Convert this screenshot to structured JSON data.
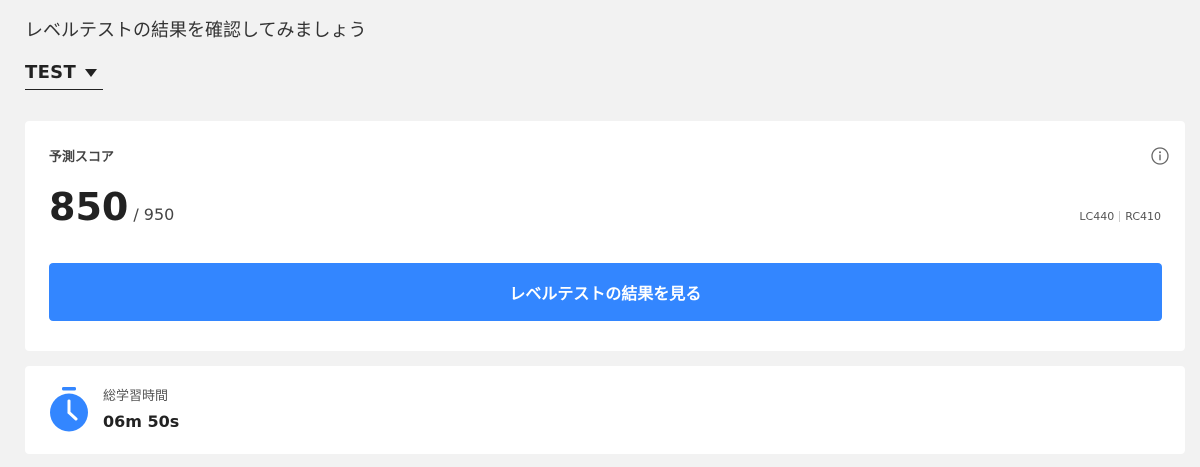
{
  "page": {
    "heading": "レベルテストの結果を確認してみましょう"
  },
  "selector": {
    "label": "TEST"
  },
  "score_card": {
    "label": "予測スコア",
    "score": "850",
    "max": "/ 950",
    "lc": "LC440",
    "rc": "RC410",
    "button_label": "レベルテストの結果を見る"
  },
  "study_time": {
    "label": "総学習時間",
    "value": "06m 50s"
  },
  "colors": {
    "accent": "#3386ff",
    "background": "#f2f2f2",
    "card": "#ffffff"
  }
}
